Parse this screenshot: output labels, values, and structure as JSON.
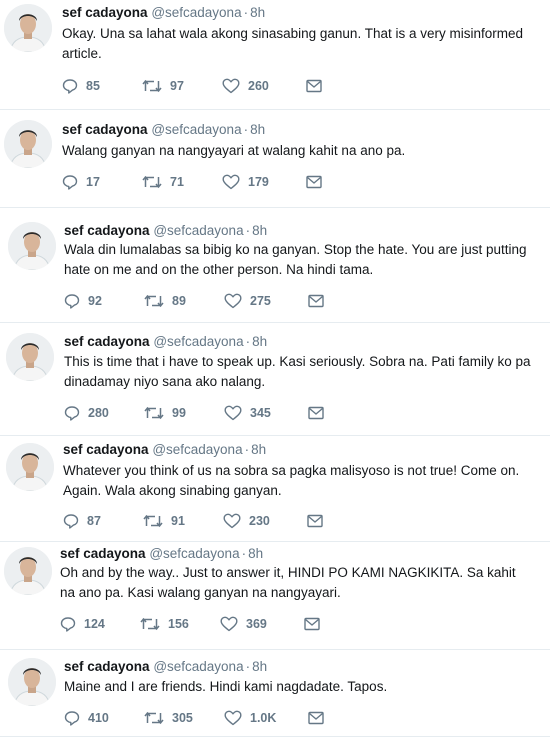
{
  "user": {
    "name": "sef cadayona",
    "handle": "@sefcadayona",
    "time": "8h"
  },
  "colors": {
    "text": "#14171a",
    "secondary": "#657786",
    "divider": "#e6ecf0"
  },
  "icons": {
    "reply": "reply-icon",
    "retweet": "retweet-icon",
    "like": "heart-icon",
    "dm": "envelope-icon"
  },
  "tweets": [
    {
      "text": "Okay. Una sa lahat wala akong sinasabing ganun. That is a very misinformed article.",
      "replies": "85",
      "retweets": "97",
      "likes": "260"
    },
    {
      "text": "Walang ganyan na nangyayari at walang kahit na ano pa.",
      "replies": "17",
      "retweets": "71",
      "likes": "179"
    },
    {
      "text": "Wala din lumalabas sa bibig ko na ganyan. Stop the hate. You are just putting hate on me and on the other person. Na hindi tama.",
      "replies": "92",
      "retweets": "89",
      "likes": "275"
    },
    {
      "text": "This is time that i have to speak up. Kasi seriously. Sobra na. Pati family ko pa dinadamay niyo sana ako nalang.",
      "replies": "280",
      "retweets": "99",
      "likes": "345"
    },
    {
      "text": "Whatever you think of us na sobra sa pagka malisyoso is not true! Come on. Again. Wala akong sinabing ganyan.",
      "replies": "87",
      "retweets": "91",
      "likes": "230"
    },
    {
      "text": "Oh and by the way.. Just to answer it, HINDI PO KAMI NAGKIKITA. Sa kahit na ano pa. Kasi walang ganyan na nangyayari.",
      "replies": "124",
      "retweets": "156",
      "likes": "369"
    },
    {
      "text": "Maine and I are friends. Hindi kami nagdadate. Tapos.",
      "replies": "410",
      "retweets": "305",
      "likes": "1.0K"
    }
  ]
}
